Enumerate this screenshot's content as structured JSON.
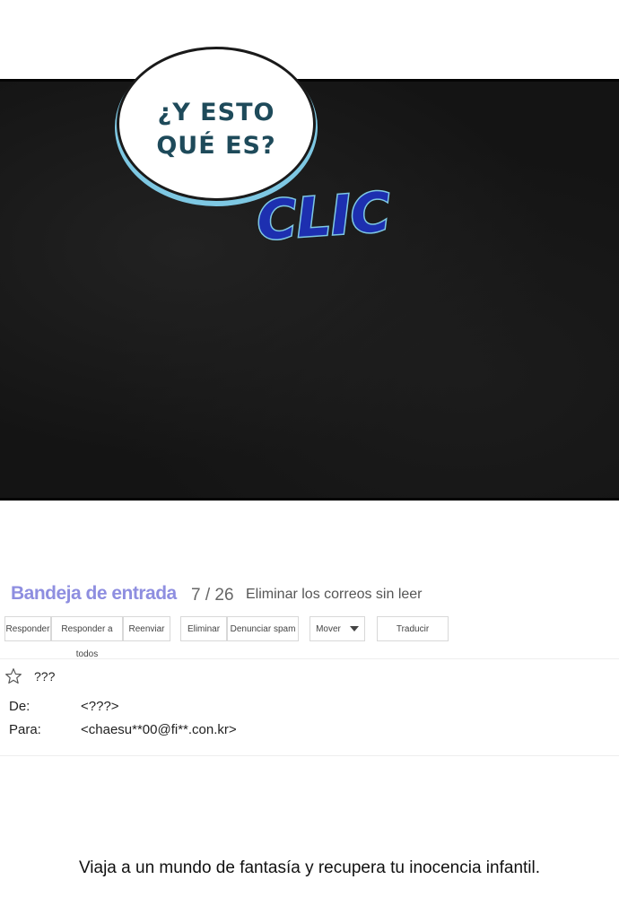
{
  "panel": {
    "speech_bubble": "¿Y ESTO QUÉ ES?",
    "sfx": "CLIC"
  },
  "mail": {
    "inbox_title": "Bandeja de entrada",
    "count": "7 / 26",
    "delete_unread": "Eliminar los correos sin leer",
    "toolbar": {
      "reply": "Responder",
      "reply_all": "Responder a todos",
      "forward": "Reenviar",
      "delete": "Eliminar",
      "report_spam": "Denunciar spam",
      "move": "Mover",
      "translate": "Traducir"
    },
    "subject": "???",
    "from_label": "De:",
    "from_value": "<???>",
    "to_label": "Para:",
    "to_value": "<chaesu**00@fi**.con.kr>",
    "icons": {
      "star": "star-outline-icon",
      "dropdown": "caret-down-icon"
    }
  },
  "footer": "Viaja a un mundo de fantasía y recupera tu inocencia infantil.",
  "colors": {
    "inbox_title": "#8e8ee0",
    "panel_background": "#141414",
    "sfx_fill": "#1d2fb0",
    "sfx_outline": "#7ec8e3"
  }
}
